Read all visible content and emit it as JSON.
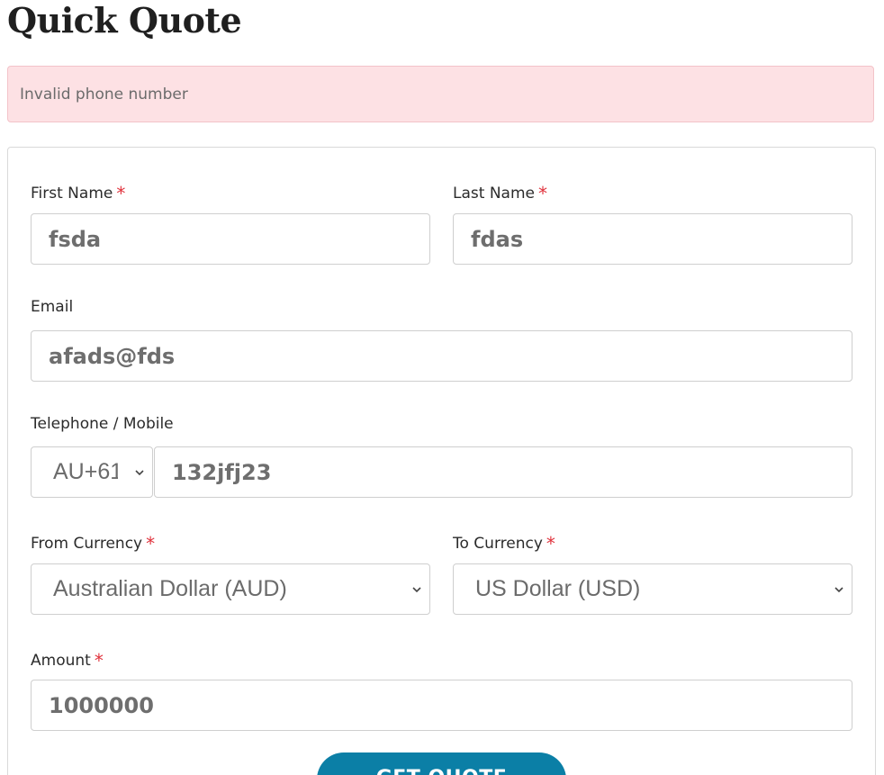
{
  "page": {
    "title": "Quick Quote"
  },
  "alert": {
    "message": "Invalid phone number"
  },
  "form": {
    "first_name": {
      "label": "First Name",
      "required_mark": "*",
      "value": "fsda"
    },
    "last_name": {
      "label": "Last Name",
      "required_mark": "*",
      "value": "fdas"
    },
    "email": {
      "label": "Email",
      "value": "afads@fds"
    },
    "telephone": {
      "label": "Telephone / Mobile",
      "country_code": "AU+61",
      "value": "132jfj23"
    },
    "from_currency": {
      "label": "From Currency",
      "required_mark": "*",
      "value": "Australian Dollar (AUD)"
    },
    "to_currency": {
      "label": "To Currency",
      "required_mark": "*",
      "value": "US Dollar (USD)"
    },
    "amount": {
      "label": "Amount",
      "required_mark": "*",
      "value": "1000000"
    },
    "submit_label": "GET QUOTE"
  },
  "colors": {
    "alert_background": "#fde1e4",
    "required_mark": "#e0333d",
    "button_background": "#0b7fa6",
    "button_text": "#ffffff"
  },
  "icons": {
    "select_arrow": "chevron-down-icon"
  }
}
